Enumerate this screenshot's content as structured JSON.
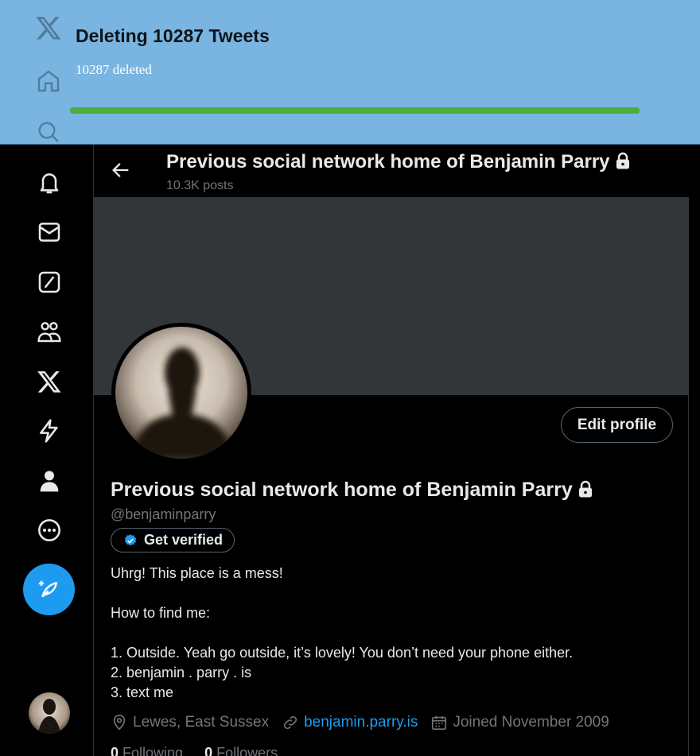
{
  "banner": {
    "title": "Deleting 10287 Tweets",
    "status": "10287 deleted",
    "progress": 1.0,
    "colors": {
      "background": "#79b5e0",
      "progress": "#4caf3f"
    }
  },
  "nav": {
    "items": [
      {
        "icon": "x-logo-icon"
      },
      {
        "icon": "home-icon"
      },
      {
        "icon": "search-icon"
      },
      {
        "icon": "bell-icon"
      },
      {
        "icon": "mail-icon"
      },
      {
        "icon": "grok-icon"
      },
      {
        "icon": "communities-icon"
      },
      {
        "icon": "premium-x-icon"
      },
      {
        "icon": "verified-orgs-icon"
      },
      {
        "icon": "profile-icon"
      },
      {
        "icon": "more-icon"
      }
    ],
    "compose_icon": "compose-feather-icon"
  },
  "header": {
    "title": "Previous social network home of Benjamin Parry",
    "post_count": "10.3K posts"
  },
  "profile": {
    "edit_label": "Edit profile",
    "display_name": "Previous social network home of Benjamin Parry",
    "handle": "@benjaminparry",
    "verify_label": "Get verified",
    "bio": "Uhrg! This place is a mess!\n\nHow to find me:\n\n1. Outside. Yeah go outside, it’s lovely! You don’t need your phone either.\n2. benjamin . parry . is\n3. text me",
    "location": "Lewes, East Sussex",
    "website": "benjamin.parry.is",
    "joined": "Joined November 2009",
    "following_count": "0",
    "following_label": "Following",
    "followers_count": "0",
    "followers_label": "Followers"
  },
  "colors": {
    "accent": "#1d9bf0",
    "cover": "#333639",
    "muted": "#71767b"
  }
}
